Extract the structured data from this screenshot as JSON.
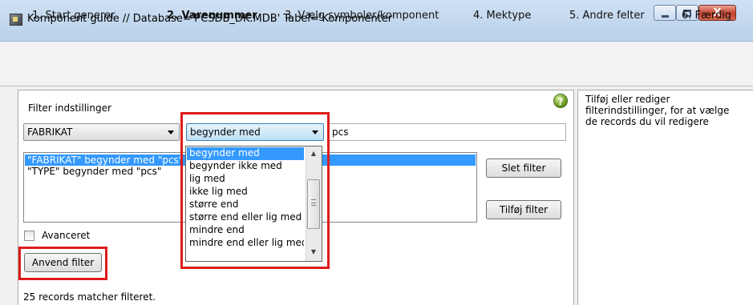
{
  "window": {
    "title": "Komponent guide  //  Database='PCSDB_DK.MDB' Tabel='Komponenter'",
    "close_glyph": "X",
    "icon": "app-icon"
  },
  "steps": [
    {
      "label": "1. Start generer",
      "active": false
    },
    {
      "label": "2. Varenummer",
      "active": true
    },
    {
      "label": "3. Vælg symboler/komponent",
      "active": false
    },
    {
      "label": "4. Mektype",
      "active": false
    },
    {
      "label": "5. Andre felter",
      "active": false
    },
    {
      "label": "6. Færdig",
      "active": false
    }
  ],
  "filter": {
    "heading": "Filter indstillinger",
    "field_value": "FABRIKAT",
    "operator_value": "begynder med",
    "input_value": "pcs",
    "help_glyph": "?",
    "list_rows": [
      "\"FABRIKAT\" begynder med \"pcs\"",
      "\"TYPE\" begynder med \"pcs\""
    ],
    "delete_button": "Slet filter",
    "add_button": "Tilføj filter",
    "advanced_label": "Avanceret",
    "apply_button": "Anvend filter",
    "status": "25 records matcher filteret."
  },
  "operator_options": [
    "begynder med",
    "begynder ikke med",
    "lig med",
    "ikke lig med",
    "større end",
    "større end eller lig med",
    "mindre end",
    "mindre end eller lig med"
  ],
  "right_panel": {
    "help_text": "Tilføj eller rediger\nfilterindstillinger, for at vælge\nde records du vil redigere"
  },
  "colors": {
    "selection": "#3399ff",
    "highlight": "#e01b1b",
    "title_bar": "#c4d9f0"
  }
}
